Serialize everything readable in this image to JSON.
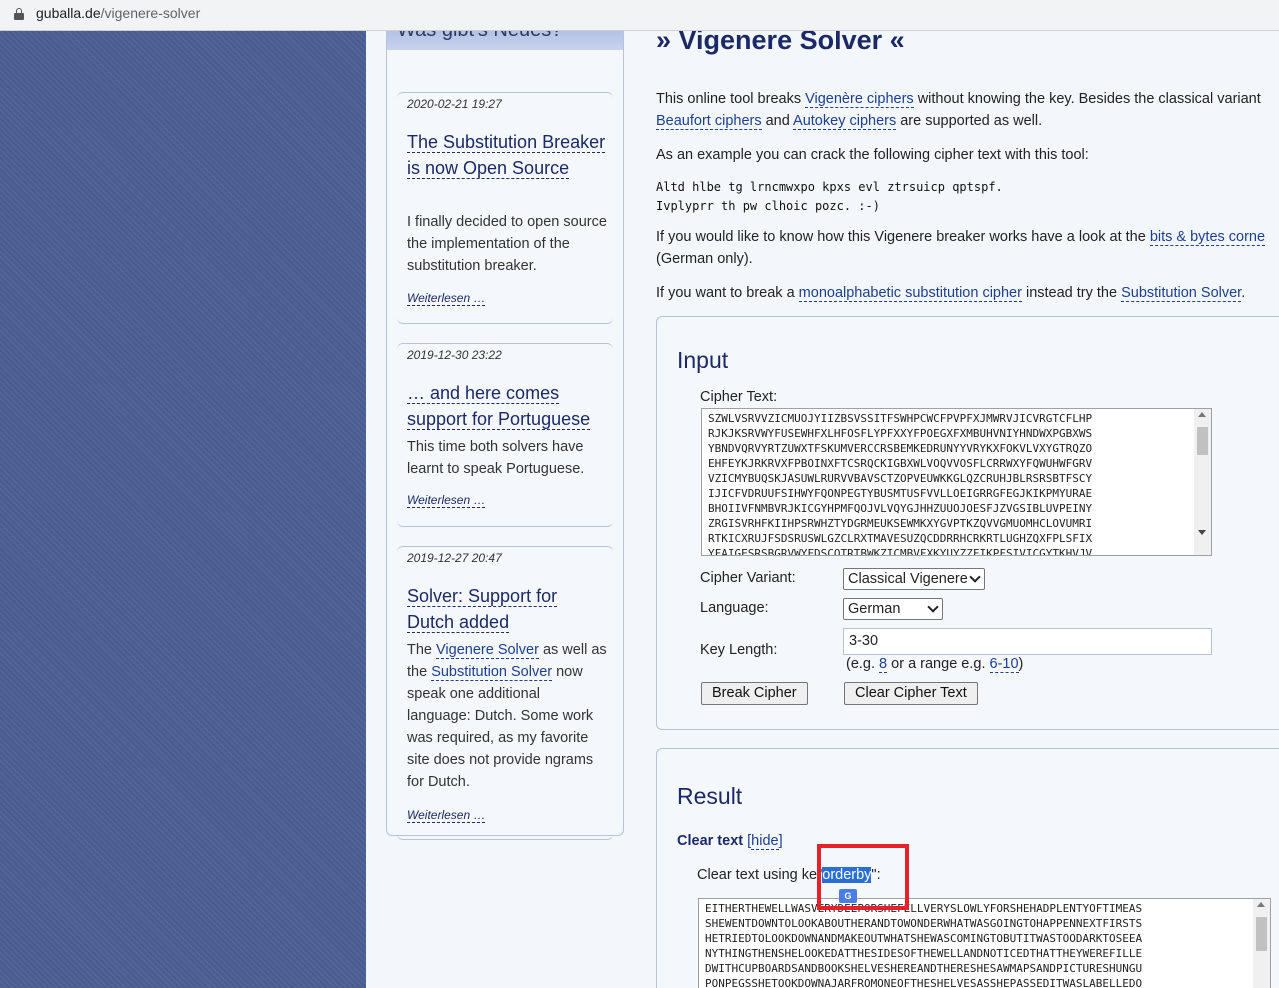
{
  "browser": {
    "url_host": "guballa.de",
    "url_path": "/vigenere-solver"
  },
  "sidebar": {
    "heading": "Was gibt's Neues?",
    "items": [
      {
        "date": "2020-02-21 19:27",
        "title": "The Substitution Breaker is now Open Source",
        "body": "I finally decided to open source the implementation of the substitution breaker.",
        "more": "Weiterlesen …"
      },
      {
        "date": "2019-12-30 23:22",
        "title": "… and here comes support for Portuguese",
        "body": "This time both solvers have learnt to speak Portuguese.",
        "more": "Weiterlesen …"
      },
      {
        "date": "2019-12-27 20:47",
        "title": "Solver: Support for Dutch added",
        "body_parts": [
          "The ",
          "Vigenere Solver",
          " as well as the ",
          "Substitution Solver",
          " now speak one additional language: Dutch. Some work was required, as my favorite site does not provide ngrams for Dutch."
        ],
        "more": "Weiterlesen …"
      }
    ]
  },
  "main": {
    "title": "» Vigenere Solver «",
    "intro1": [
      "This online tool breaks ",
      "Vigenère ciphers",
      " without knowing the key. Besides the classical variant"
    ],
    "intro2": [
      "Beaufort ciphers",
      " and ",
      "Autokey ciphers",
      " are supported as well."
    ],
    "example_text": "As an example you can crack the following cipher text with this tool:",
    "example_cipher_1": "Altd hlbe tg lrncmwxpo kpxs evl ztrsuicp qptspf.",
    "example_cipher_2": "Ivplyprr th pw clhoic pozc. :-)",
    "how1": [
      "If you would like to know how this Vigenere breaker works have a look at the ",
      "bits & bytes corne"
    ],
    "how2": "(German only).",
    "subst": [
      "If you want to break a ",
      "monoalphabetic substitution cipher",
      " instead try the ",
      "Substitution Solver",
      "."
    ]
  },
  "input_panel": {
    "heading": "Input",
    "cipher_label": "Cipher Text:",
    "cipher_text": "SZWLVSRVVZICMUOJYIIZBSVSSITFSWHPCWCFPVPFXJMWRVJICVRGTCFLHP\nRJKJKSRVWYFUSEWHFXLHFOSFLYPFXXYFPOEGXFXMBUHVNIYHNDWXPGBXWS\nYBNDVQRVYRTZUWXTFSKUMVERCCRSBEMKEDRUNYYVRYKXFOKVLVXYGTRQZO\nEHFEYKJRKRVXFPBOINXFTCSRQCKIGBXWLVOQVVOSFLCRRWXYFQWUHWFGRV\nVZICMYBUQSKJASUWLRURVVBAVSCTZOPVEUWKKGLQZCRUHJBLRSRSBTFSCY\nIJICFVDRUUFSIHWYFQONPEGTYBUSMTUSFVVLLOEIGRRGFEGJKIKPMYURAE\nBHOIIVFNMBVRJKICGYHPMFQOJVLVQYGJHHZUUOJOESFJZVGSIBLUVPEINY\nZRGISVRHFKIIHPSRWHZTYDGRMEUKSEWMKXYGVPTKZQVVGMUOMHCLOVUMRI\nRTKICXRUJFSDSRUSWLGZCLRXTMAVESUZQCDDRRHCRKRTLUGHZQXFPLSFIX\nYFAIGESRSBGRVWYFDSCOTRTBWKZICMBVFXKYUYZZFIKPFSIVICGYTKHVJV",
    "variant_label": "Cipher Variant:",
    "variant_value": "Classical Vigenere",
    "language_label": "Language:",
    "language_value": "German",
    "keylen_label": "Key Length:",
    "keylen_value": "3-30",
    "keylen_hint": [
      "(e.g. ",
      "8",
      " or a range e.g. ",
      "6-10",
      ")"
    ],
    "break_button": "Break Cipher",
    "clear_button": "Clear Cipher Text"
  },
  "result_panel": {
    "heading": "Result",
    "clear_label": "Clear text",
    "hide_link": "hide",
    "key_prefix": "Clear text using ke",
    "key_quote_open": "\"",
    "key": "orderby",
    "key_suffix": "\":",
    "clear_text": "EITHERTHEWELLWASVERYDEEPORSHEFELLVERYSLOWLYFORSHEHADPLENTYOFTIMEAS\nSHEWENTDOWNTOLOOKABOUTHERANDTOWONDERWHATWASGOINGTOHAPPENNEXTFIRSTS\nHETRIEDTOLOOKDOWNANDMAKEOUTWHATSHEWASCOMINGTOBUTITWASTOODARKTOSEEA\nNYTHINGTHENSHELOOKEDATTHESIDESOFTHEWELLANDNOTICEDTHATTHEYWEREFILLE\nDWITHCUPBOARDSANDBOOKSHELVESHEREANDTHERESHESAWMAPSANDPICTURESHUNGU\nPONPEGSSHETOOKDOWNAJARFROMONEOFTHESHELVESASSHEPASSEDITWASLABELLEDO",
    "translate_badge": "G"
  }
}
